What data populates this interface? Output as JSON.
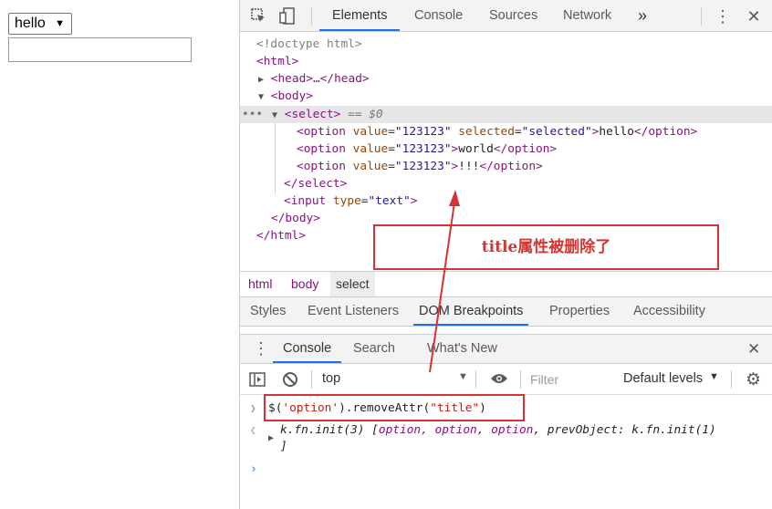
{
  "page": {
    "select_value": "hello",
    "input_value": ""
  },
  "devtools": {
    "tabs": [
      "Elements",
      "Console",
      "Sources",
      "Network"
    ],
    "more": "»",
    "dom": {
      "doctype": "<!doctype html>",
      "html_open": "<html>",
      "head": "<head>…</head>",
      "body_open": "<body>",
      "select_open": "<select>",
      "select_marker": " == $0",
      "option1": {
        "attr": "value",
        "value": "\"123123\"",
        "attr2": "selected",
        "value2": "\"selected\"",
        "text": "hello"
      },
      "option2": {
        "attr": "value",
        "value": "\"123123\"",
        "text": "world"
      },
      "option3": {
        "attr": "value",
        "value": "\"123123\"",
        "text": "!!!"
      },
      "select_close": "</select>",
      "input": {
        "attr": "type",
        "value": "\"text\""
      },
      "body_close": "</body>",
      "html_close": "</html>"
    },
    "annotation": "title属性被删除了",
    "breadcrumbs": [
      "html",
      "body",
      "select"
    ],
    "subtabs": [
      "Styles",
      "Event Listeners",
      "DOM Breakpoints",
      "Properties",
      "Accessibility"
    ],
    "drawer_tabs": [
      "Console",
      "Search",
      "What's New"
    ],
    "console_toolbar": {
      "context": "top",
      "filter_placeholder": "Filter",
      "levels": "Default levels"
    },
    "console": {
      "command_prefix": "$(",
      "command_string": "'option'",
      "command_suffix": ").removeAttr(",
      "command_arg": "\"title\"",
      "command_end": ")",
      "result_a": "k.fn.init(3) [",
      "result_items": "option, option, option",
      "result_b": ", prevObject: k.fn.init(1)",
      "result_c": "]"
    }
  },
  "colors": {
    "accent": "#1a73e8",
    "annotation_red": "#d93232",
    "tag": "#881280",
    "attr": "#994500",
    "value": "#1a1aa6"
  }
}
